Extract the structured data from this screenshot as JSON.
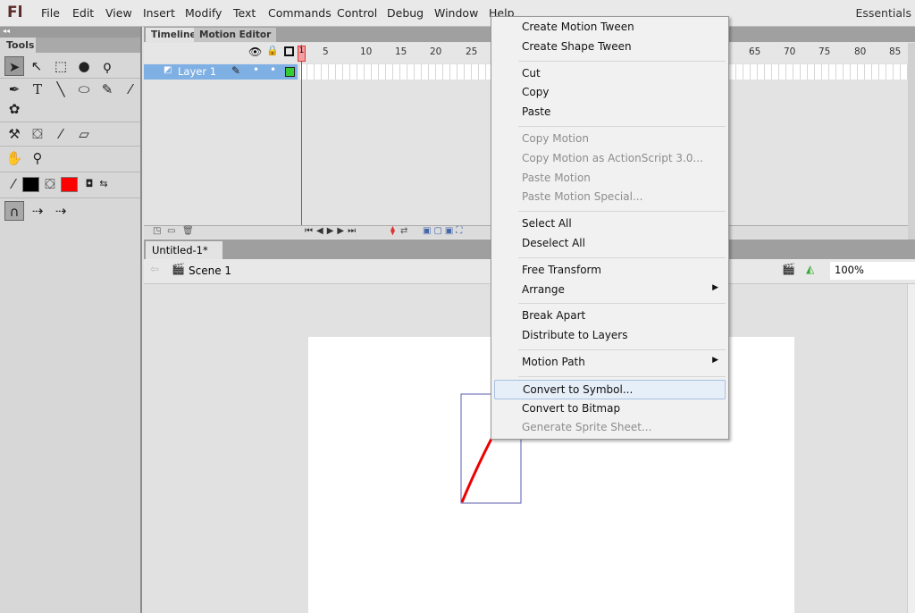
{
  "app": {
    "logo": "Fl",
    "workspace": "Essentials"
  },
  "menu": [
    "File",
    "Edit",
    "View",
    "Insert",
    "Modify",
    "Text",
    "Commands",
    "Control",
    "Debug",
    "Window",
    "Help"
  ],
  "tools": {
    "title": "Tools",
    "stroke_color": "#000000",
    "fill_color": "#ff0000"
  },
  "timeline": {
    "tabs": [
      "Timeline",
      "Motion Editor"
    ],
    "layer": "Layer 1",
    "frame_numbers": [
      "1",
      "5",
      "10",
      "15",
      "20",
      "25",
      "65",
      "70",
      "75",
      "80",
      "85"
    ],
    "current_frame": "1"
  },
  "document": {
    "tab": "Untitled-1*",
    "close": "×",
    "scene": "Scene 1",
    "zoom": "100%"
  },
  "context_menu": [
    {
      "label": "Create Motion Tween",
      "enabled": true
    },
    {
      "label": "Create Shape Tween",
      "enabled": true
    },
    {
      "sep": true
    },
    {
      "label": "Cut",
      "enabled": true
    },
    {
      "label": "Copy",
      "enabled": true
    },
    {
      "label": "Paste",
      "enabled": true
    },
    {
      "sep": true
    },
    {
      "label": "Copy Motion",
      "enabled": false
    },
    {
      "label": "Copy Motion as ActionScript 3.0...",
      "enabled": false
    },
    {
      "label": "Paste Motion",
      "enabled": false
    },
    {
      "label": "Paste Motion Special...",
      "enabled": false
    },
    {
      "sep": true
    },
    {
      "label": "Select All",
      "enabled": true
    },
    {
      "label": "Deselect All",
      "enabled": true
    },
    {
      "sep": true
    },
    {
      "label": "Free Transform",
      "enabled": true
    },
    {
      "label": "Arrange",
      "enabled": true,
      "submenu": true
    },
    {
      "sep": true
    },
    {
      "label": "Break Apart",
      "enabled": true
    },
    {
      "label": "Distribute to Layers",
      "enabled": true
    },
    {
      "sep": true
    },
    {
      "label": "Motion Path",
      "enabled": true,
      "submenu": true
    },
    {
      "sep": true
    },
    {
      "label": "Convert to Symbol...",
      "enabled": true,
      "highlighted": true
    },
    {
      "label": "Convert to Bitmap",
      "enabled": true
    },
    {
      "label": "Generate Sprite Sheet...",
      "enabled": false
    }
  ]
}
